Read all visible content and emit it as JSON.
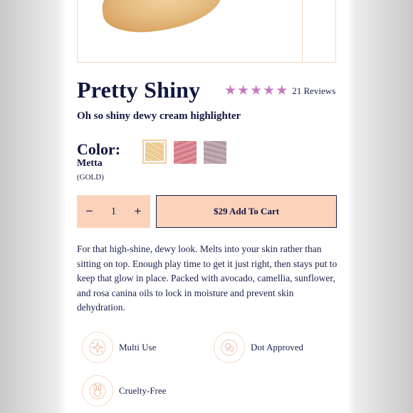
{
  "product": {
    "title": "Pretty Shiny",
    "subtitle": "Oh so shiny dewy cream highlighter",
    "rating": 5,
    "reviews_label": "21 Reviews"
  },
  "color": {
    "label": "Color:",
    "selected_name": "Metta",
    "selected_code": "(GOLD)",
    "swatches": [
      "gold",
      "pink",
      "mauve"
    ],
    "swatch_colors": [
      "#e9c484",
      "#d47884",
      "#b29aa2"
    ]
  },
  "quantity": {
    "minus": "−",
    "value": "1",
    "plus": "+"
  },
  "cart": {
    "add_label": "$29 Add To Cart"
  },
  "description": "For that high-shine, dewy look. Melts into your skin rather than sitting on top. Enough play time to get it just right, then stays put to keep that glow in place. Packed with avocado, camellia, sunflower, and rosa canina oils to lock in moisture and prevent skin dehydration.",
  "features": [
    {
      "label": "Multi Use",
      "icon": "sparkle-icon"
    },
    {
      "label": "Dot Approved",
      "icon": "dot-approved-icon"
    },
    {
      "label": "Cruelty-Free",
      "icon": "bunny-icon"
    }
  ],
  "colors": {
    "accent": "#fbd3bb",
    "star": "#c67ac0",
    "text": "#1a1f4a"
  }
}
